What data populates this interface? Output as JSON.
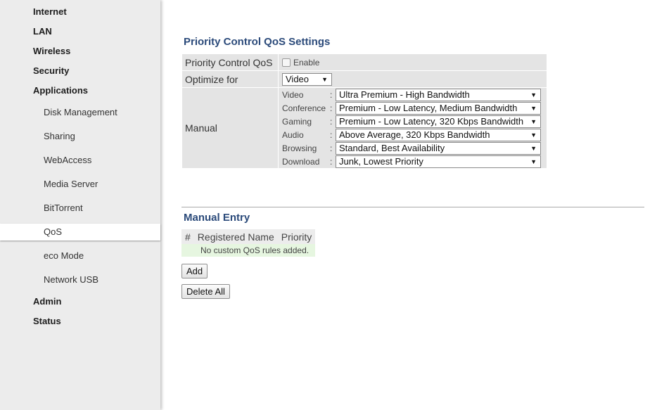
{
  "sidebar": {
    "items": [
      {
        "label": "Internet"
      },
      {
        "label": "LAN"
      },
      {
        "label": "Wireless"
      },
      {
        "label": "Security"
      },
      {
        "label": "Applications"
      },
      {
        "label": "Disk Management"
      },
      {
        "label": "Sharing"
      },
      {
        "label": "WebAccess"
      },
      {
        "label": "Media Server"
      },
      {
        "label": "BitTorrent"
      },
      {
        "label": "QoS"
      },
      {
        "label": "eco Mode"
      },
      {
        "label": "Network USB"
      },
      {
        "label": "Admin"
      },
      {
        "label": "Status"
      }
    ],
    "active": "QoS"
  },
  "qos_settings": {
    "title": "Priority Control QoS Settings",
    "priority_label": "Priority Control QoS",
    "enable_label": "Enable",
    "enable_checked": false,
    "optimize_label": "Optimize for",
    "optimize_value": "Video",
    "manual_label": "Manual",
    "manual_rows": [
      {
        "name": "Video",
        "value": "Ultra Premium - High Bandwidth"
      },
      {
        "name": "Conference",
        "value": "Premium - Low Latency, Medium Bandwidth"
      },
      {
        "name": "Gaming",
        "value": "Premium - Low Latency, 320 Kbps Bandwidth"
      },
      {
        "name": "Audio",
        "value": "Above Average, 320 Kbps Bandwidth"
      },
      {
        "name": "Browsing",
        "value": "Standard, Best Availability"
      },
      {
        "name": "Download",
        "value": "Junk, Lowest Priority"
      }
    ],
    "colon": ":"
  },
  "manual_entry": {
    "title": "Manual Entry",
    "columns": [
      "#",
      "Registered Name",
      "Priority"
    ],
    "empty_message": "No custom QoS rules added.",
    "add_label": "Add",
    "delete_all_label": "Delete All"
  },
  "icons": {
    "dropdown": "dropdown-arrow-icon",
    "arrow_glyph": "▼"
  },
  "colors": {
    "section_title": "#2b4a7a",
    "sidebar_bg": "#ececec",
    "table_bg": "#e4e4e4",
    "empty_row_bg": "#e6f6e0"
  }
}
